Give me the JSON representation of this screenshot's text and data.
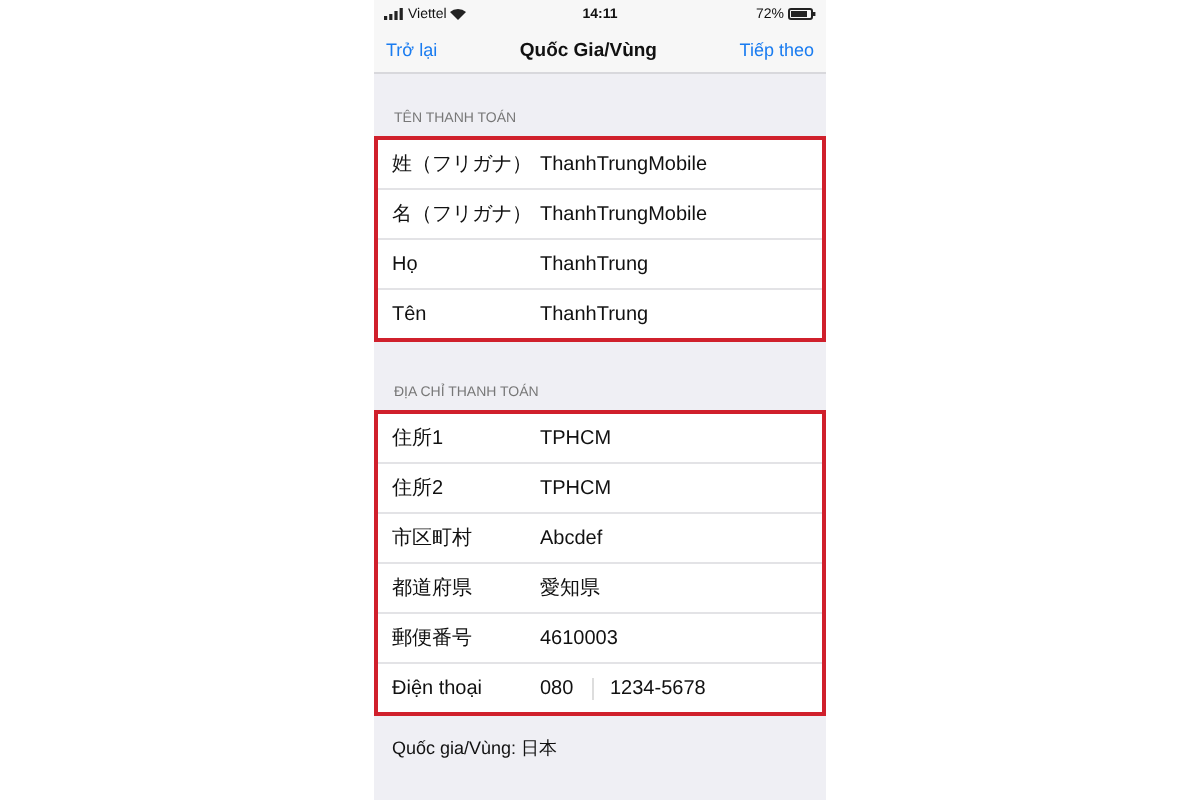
{
  "status_bar": {
    "carrier": "Viettel",
    "time": "14:11",
    "battery": "72%"
  },
  "nav": {
    "back": "Trở lại",
    "title": "Quốc Gia/Vùng",
    "next": "Tiếp theo"
  },
  "sections": [
    {
      "header": "TÊN THANH TOÁN",
      "highlighted": true,
      "rows": [
        {
          "kind": "text",
          "label": "姓（フリガナ）",
          "value": "ThanhTrungMobile"
        },
        {
          "kind": "text",
          "label": "名（フリガナ）",
          "value": "ThanhTrungMobile"
        },
        {
          "kind": "text",
          "label": "Họ",
          "value": "ThanhTrung"
        },
        {
          "kind": "text",
          "label": "Tên",
          "value": "ThanhTrung"
        }
      ]
    },
    {
      "header": "ĐỊA CHỈ THANH TOÁN",
      "highlighted": true,
      "rows": [
        {
          "kind": "text",
          "label": "住所1",
          "value": "TPHCM"
        },
        {
          "kind": "text",
          "label": "住所2",
          "value": "TPHCM"
        },
        {
          "kind": "text",
          "label": "市区町村",
          "value": "Abcdef"
        },
        {
          "kind": "text",
          "label": "都道府県",
          "value": "愛知県"
        },
        {
          "kind": "text",
          "label": "郵便番号",
          "value": "4610003"
        },
        {
          "kind": "phone",
          "label": "Điện thoại",
          "value": "080",
          "value_2": "1234-5678"
        }
      ]
    }
  ],
  "footer": "Quốc gia/Vùng: 日本"
}
